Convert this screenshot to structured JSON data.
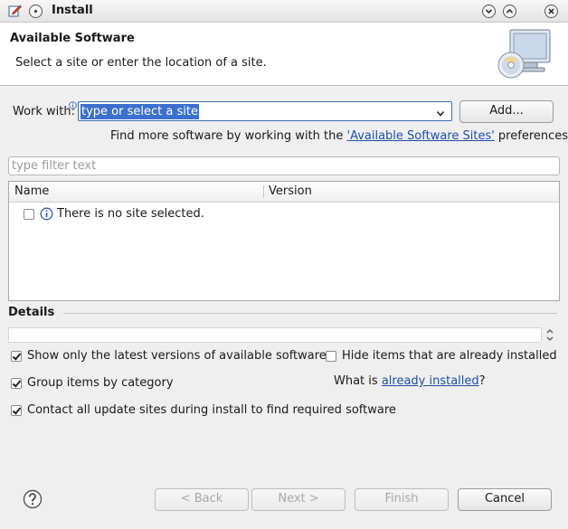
{
  "window": {
    "title": "Install"
  },
  "header": {
    "title": "Available Software",
    "description": "Select a site or enter the location of a site."
  },
  "work_with": {
    "label": "Work with:",
    "value": "type or select a site",
    "add_button": "Add...",
    "find_more_prefix": "Find more software by working with the ",
    "find_more_link": "'Available Software Sites'",
    "find_more_suffix": " preferences."
  },
  "filter": {
    "placeholder": "type filter text"
  },
  "table": {
    "columns": [
      "Name",
      "Version"
    ],
    "rows": [
      {
        "text": "There is no site selected.",
        "checked": false
      }
    ]
  },
  "details": {
    "label": "Details"
  },
  "options": {
    "show_latest": {
      "label": "Show only the latest versions of available software",
      "checked": true
    },
    "hide_installed": {
      "label": "Hide items that are already installed",
      "checked": false
    },
    "group_by_category": {
      "label": "Group items by category",
      "checked": true
    },
    "what_is_prefix": "What is ",
    "what_is_link": "already installed",
    "what_is_suffix": "?",
    "contact_sites": {
      "label": "Contact all update sites during install to find required software",
      "checked": true
    }
  },
  "footer": {
    "back": "< Back",
    "next": "Next >",
    "finish": "Finish",
    "cancel": "Cancel"
  }
}
